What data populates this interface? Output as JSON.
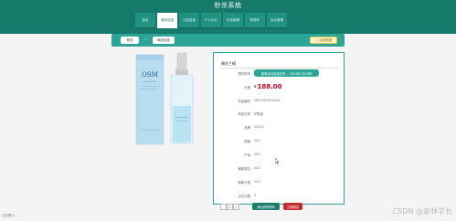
{
  "app": {
    "title": "秒杀系统"
  },
  "nav": {
    "items": [
      {
        "label": "首页",
        "active": false
      },
      {
        "label": "商品信息",
        "active": true
      },
      {
        "label": "公告信息",
        "active": false
      },
      {
        "label": "个人中心",
        "active": false
      },
      {
        "label": "在线客服",
        "active": false
      },
      {
        "label": "购物车",
        "active": false
      },
      {
        "label": "后台管理",
        "active": false
      }
    ]
  },
  "breadcrumb": {
    "home": "首页",
    "separator": "/",
    "current": "商品信息",
    "fav_button": "☆ 点我收藏"
  },
  "product": {
    "brand_text": "OSM",
    "sub_text": "OSM OSMOSE",
    "panel_title": "播花兰橘",
    "fields": [
      {
        "label": "限时秒杀",
        "value": "距离活动结束还有 ：2024年7月18号"
      },
      {
        "label": "价格",
        "value": "188.00",
        "currency": "¥"
      },
      {
        "label": "商品编号",
        "value": "1647007011044"
      },
      {
        "label": "商品分类",
        "value": "护肤品"
      },
      {
        "label": "品牌",
        "value": "22222"
      },
      {
        "label": "规格",
        "value": "220"
      },
      {
        "label": "产地",
        "value": "220"
      },
      {
        "label": "最新报名",
        "value": "220"
      },
      {
        "label": "最新价格",
        "value": "220"
      },
      {
        "label": "点击次数",
        "value": "5"
      }
    ],
    "quantity": {
      "minus": "-",
      "value": "1",
      "plus": "+"
    },
    "add_to_cart": "添加到购物车",
    "buy_now": "立即购买"
  },
  "footer": {
    "text": "正在载入..."
  },
  "watermark": "CSDN @家林学长",
  "colors": {
    "header": "#167a6a",
    "accent": "#2aa596",
    "price": "#d0021b",
    "buy": "#c62d2d"
  }
}
